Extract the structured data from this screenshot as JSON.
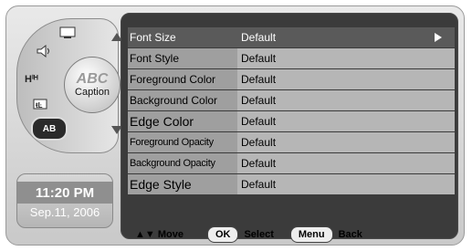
{
  "clock": {
    "time": "11:20 PM",
    "date": "Sep.11, 2006"
  },
  "wheel": {
    "center_icon_text": "ABC",
    "center_label": "Caption",
    "ab_label": "AB",
    "icons": [
      "screen-icon",
      "sound-icon",
      "channel-icon",
      "parental-lock-icon"
    ]
  },
  "menu": {
    "items": [
      {
        "label": "Font Size",
        "value": "Default",
        "active": true
      },
      {
        "label": "Font Style",
        "value": "Default"
      },
      {
        "label": "Foreground Color",
        "value": "Default"
      },
      {
        "label": "Background Color",
        "value": "Default"
      },
      {
        "label": "Edge Color",
        "value": "Default"
      },
      {
        "label": "Foreground Opacity",
        "value": "Default"
      },
      {
        "label": "Background Opacity",
        "value": "Default"
      },
      {
        "label": "Edge Style",
        "value": "Default"
      }
    ]
  },
  "footer": {
    "move_label": "▲▼ Move",
    "ok_label": "OK",
    "select_label": "Select",
    "menu_label": "Menu",
    "back_label": "Back"
  },
  "colors": {
    "panel_bg": "#3b3b3b",
    "row_bg": "#b6b6b6",
    "label_bg": "#9f9f9f",
    "active_row_bg": "#5a5a5a",
    "clock_time_bg": "#8f8f8f"
  }
}
